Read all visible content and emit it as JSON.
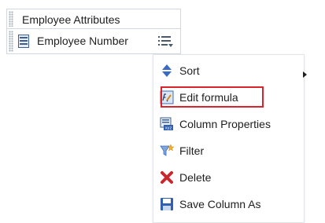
{
  "header": {
    "label": "Employee Attributes"
  },
  "column": {
    "label": "Employee Number",
    "menu_icon": "list-menu-icon"
  },
  "menu": {
    "items": [
      {
        "label": "Sort",
        "icon": "sort-icon",
        "has_submenu": true
      },
      {
        "label": "Edit formula",
        "icon": "edit-formula-icon",
        "highlighted": true
      },
      {
        "label": "Column Properties",
        "icon": "column-properties-icon"
      },
      {
        "label": "Filter",
        "icon": "filter-icon"
      },
      {
        "label": "Delete",
        "icon": "delete-icon"
      },
      {
        "label": "Save Column As",
        "icon": "save-icon"
      }
    ]
  },
  "colors": {
    "highlight_border": "#d9242b",
    "cell_border": "#d3d8de",
    "icon_blue": "#3a6bc4",
    "delete_red": "#c8282d"
  }
}
